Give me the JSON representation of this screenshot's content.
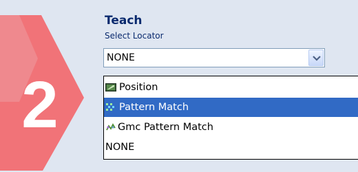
{
  "step": {
    "number": "2",
    "accent": "#f17378"
  },
  "section": {
    "title": "Teach",
    "subtitle": "Select Locator"
  },
  "locator_combo": {
    "value": "NONE",
    "icon": "chevron-down-icon"
  },
  "dropdown": {
    "items": [
      {
        "label": "Position",
        "icon": "position-icon",
        "selected": false
      },
      {
        "label": "Pattern Match",
        "icon": "pattern-match-icon",
        "selected": true
      },
      {
        "label": "Gmc Pattern Match",
        "icon": "gmc-pattern-match-icon",
        "selected": false
      },
      {
        "label": "NONE",
        "icon": "",
        "selected": false
      }
    ],
    "selection_color": "#316ac5"
  }
}
